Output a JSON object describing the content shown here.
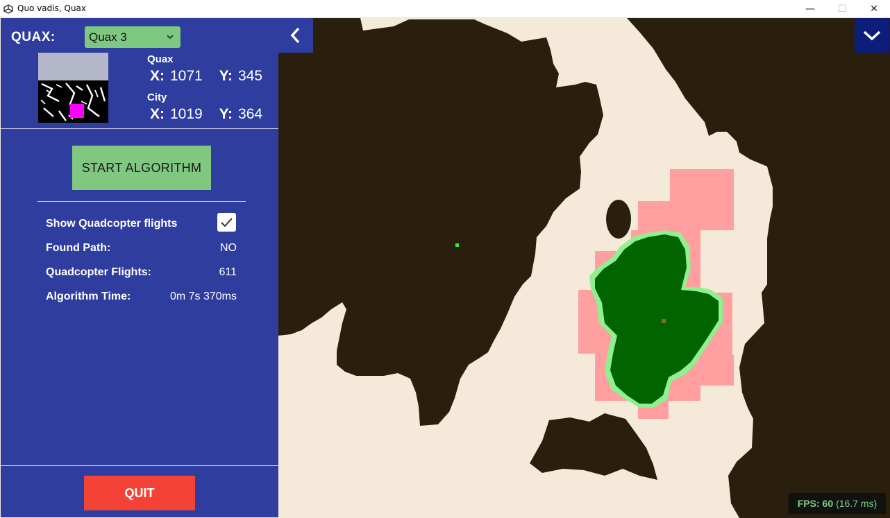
{
  "window": {
    "title": "Quo vadis, Quax",
    "minimize_glyph": "—",
    "maximize_glyph": "☐",
    "close_glyph": "✕"
  },
  "panel": {
    "quax_label": "QUAX:",
    "quax_select": {
      "value": "Quax 3"
    },
    "quax_section": {
      "heading": "Quax",
      "x_label": "X:",
      "x_value": "1071",
      "y_label": "Y:",
      "y_value": "345"
    },
    "city_section": {
      "heading": "City",
      "x_label": "X:",
      "x_value": "1019",
      "y_label": "Y:",
      "y_value": "364"
    },
    "start_button": "START ALGORITHM",
    "stats": {
      "show_flights_label": "Show Quadcopter flights",
      "show_flights_checked": true,
      "found_path_label": "Found Path:",
      "found_path_value": "NO",
      "flights_label": "Quadcopter Flights:",
      "flights_value": "611",
      "time_label": "Algorithm Time:",
      "time_value": "0m 7s 370ms"
    },
    "quit_button": "QUIT"
  },
  "fps": {
    "label": "FPS: 60",
    "detail": "(16.7 ms)"
  },
  "colors": {
    "panel_bg": "#2f3d9f",
    "button_green": "#7fc87f",
    "quit_red": "#f44336",
    "terrain_dark": "#2a1e0d",
    "terrain_light": "#f5e9d9",
    "explored_pink": "#ff9f9f",
    "city_green": "#006400",
    "city_border": "#8ff08f",
    "marker_pink": "#ff00ff"
  },
  "icons": {
    "app": "unity-icon",
    "collapse": "chevron-left-icon",
    "expand": "chevron-down-icon",
    "select": "chevron-down-icon",
    "checkbox": "check-icon"
  }
}
